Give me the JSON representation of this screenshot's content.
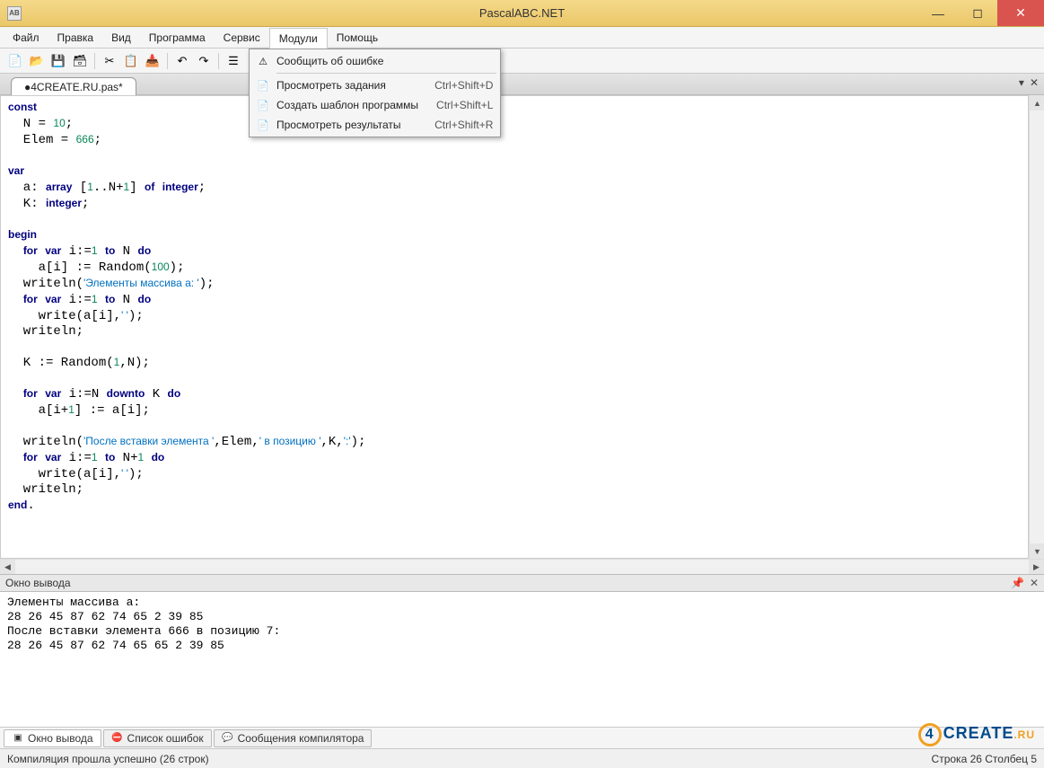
{
  "window": {
    "title": "PascalABC.NET",
    "app_icon_text": "AB"
  },
  "menu": {
    "items": [
      "Файл",
      "Правка",
      "Вид",
      "Программа",
      "Сервис",
      "Модули",
      "Помощь"
    ],
    "active_index": 5,
    "dropdown": [
      {
        "label": "Сообщить об ошибке",
        "shortcut": "",
        "icon": "warn"
      },
      {
        "sep": true
      },
      {
        "label": "Просмотреть задания",
        "shortcut": "Ctrl+Shift+D",
        "icon": "doc"
      },
      {
        "label": "Создать шаблон программы",
        "shortcut": "Ctrl+Shift+L",
        "icon": "doc"
      },
      {
        "label": "Просмотреть результаты",
        "shortcut": "Ctrl+Shift+R",
        "icon": "doc"
      }
    ]
  },
  "toolbar_icons": [
    "new",
    "open",
    "save",
    "saveall",
    "|",
    "cut",
    "copy",
    "paste",
    "|",
    "undo",
    "redo",
    "|",
    "prop",
    "stepover",
    "|",
    "run"
  ],
  "tab": {
    "label": "●4CREATE.RU.pas*"
  },
  "output_panel": {
    "title": "Окно вывода"
  },
  "output_text": "Элементы массива a:\n28 26 45 87 62 74 65 2 39 85\nПосле вставки элемента 666 в позицию 7:\n28 26 45 87 62 74 65 65 2 39 85",
  "bottom_tabs": [
    {
      "label": "Окно вывода",
      "icon": "out",
      "active": true
    },
    {
      "label": "Список ошибок",
      "icon": "err",
      "active": false
    },
    {
      "label": "Сообщения компилятора",
      "icon": "msg",
      "active": false
    }
  ],
  "status": {
    "left": "Компиляция прошла успешно (26 строк)",
    "right": "Строка 26 Столбец 5"
  },
  "code_tokens": [
    [
      "kw",
      "const"
    ],
    [
      "nl"
    ],
    [
      "tx",
      "  N = "
    ],
    [
      "num",
      "10"
    ],
    [
      "tx",
      ";"
    ],
    [
      "nl"
    ],
    [
      "tx",
      "  Elem = "
    ],
    [
      "num",
      "666"
    ],
    [
      "tx",
      ";"
    ],
    [
      "nl"
    ],
    [
      "nl"
    ],
    [
      "kw",
      "var"
    ],
    [
      "nl"
    ],
    [
      "tx",
      "  a: "
    ],
    [
      "kw",
      "array"
    ],
    [
      "tx",
      " ["
    ],
    [
      "num",
      "1"
    ],
    [
      "tx",
      ".."
    ],
    [
      "tx",
      "N+"
    ],
    [
      "num",
      "1"
    ],
    [
      "tx",
      "] "
    ],
    [
      "kw",
      "of"
    ],
    [
      "tx",
      " "
    ],
    [
      "kw",
      "integer"
    ],
    [
      "tx",
      ";"
    ],
    [
      "nl"
    ],
    [
      "tx",
      "  K: "
    ],
    [
      "kw",
      "integer"
    ],
    [
      "tx",
      ";"
    ],
    [
      "nl"
    ],
    [
      "nl"
    ],
    [
      "kw",
      "begin"
    ],
    [
      "nl"
    ],
    [
      "tx",
      "  "
    ],
    [
      "kw",
      "for"
    ],
    [
      "tx",
      " "
    ],
    [
      "kw",
      "var"
    ],
    [
      "tx",
      " i:="
    ],
    [
      "num",
      "1"
    ],
    [
      "tx",
      " "
    ],
    [
      "kw",
      "to"
    ],
    [
      "tx",
      " N "
    ],
    [
      "kw",
      "do"
    ],
    [
      "nl"
    ],
    [
      "tx",
      "    a[i] := Random("
    ],
    [
      "num",
      "100"
    ],
    [
      "tx",
      ");"
    ],
    [
      "nl"
    ],
    [
      "tx",
      "  writeln("
    ],
    [
      "str",
      "'Элементы массива a: '"
    ],
    [
      "tx",
      ");"
    ],
    [
      "nl"
    ],
    [
      "tx",
      "  "
    ],
    [
      "kw",
      "for"
    ],
    [
      "tx",
      " "
    ],
    [
      "kw",
      "var"
    ],
    [
      "tx",
      " i:="
    ],
    [
      "num",
      "1"
    ],
    [
      "tx",
      " "
    ],
    [
      "kw",
      "to"
    ],
    [
      "tx",
      " N "
    ],
    [
      "kw",
      "do"
    ],
    [
      "nl"
    ],
    [
      "tx",
      "    write(a[i],"
    ],
    [
      "str",
      "' '"
    ],
    [
      "tx",
      ");"
    ],
    [
      "nl"
    ],
    [
      "tx",
      "  writeln;"
    ],
    [
      "nl"
    ],
    [
      "nl"
    ],
    [
      "tx",
      "  K := Random("
    ],
    [
      "num",
      "1"
    ],
    [
      "tx",
      ",N);"
    ],
    [
      "nl"
    ],
    [
      "nl"
    ],
    [
      "tx",
      "  "
    ],
    [
      "kw",
      "for"
    ],
    [
      "tx",
      " "
    ],
    [
      "kw",
      "var"
    ],
    [
      "tx",
      " i:=N "
    ],
    [
      "kw",
      "downto"
    ],
    [
      "tx",
      " K "
    ],
    [
      "kw",
      "do"
    ],
    [
      "nl"
    ],
    [
      "tx",
      "    a[i+"
    ],
    [
      "num",
      "1"
    ],
    [
      "tx",
      "] := a[i];"
    ],
    [
      "nl"
    ],
    [
      "nl"
    ],
    [
      "tx",
      "  writeln("
    ],
    [
      "str",
      "'После вставки элемента '"
    ],
    [
      "tx",
      ",Elem,"
    ],
    [
      "str",
      "' в позицию '"
    ],
    [
      "tx",
      ",K,"
    ],
    [
      "str",
      "':'"
    ],
    [
      "tx",
      ");"
    ],
    [
      "nl"
    ],
    [
      "tx",
      "  "
    ],
    [
      "kw",
      "for"
    ],
    [
      "tx",
      " "
    ],
    [
      "kw",
      "var"
    ],
    [
      "tx",
      " i:="
    ],
    [
      "num",
      "1"
    ],
    [
      "tx",
      " "
    ],
    [
      "kw",
      "to"
    ],
    [
      "tx",
      " N+"
    ],
    [
      "num",
      "1"
    ],
    [
      "tx",
      " "
    ],
    [
      "kw",
      "do"
    ],
    [
      "nl"
    ],
    [
      "tx",
      "    write(a[i],"
    ],
    [
      "str",
      "' '"
    ],
    [
      "tx",
      ");"
    ],
    [
      "nl"
    ],
    [
      "tx",
      "  writeln;"
    ],
    [
      "nl"
    ],
    [
      "kw",
      "end"
    ],
    [
      "tx",
      "."
    ]
  ]
}
